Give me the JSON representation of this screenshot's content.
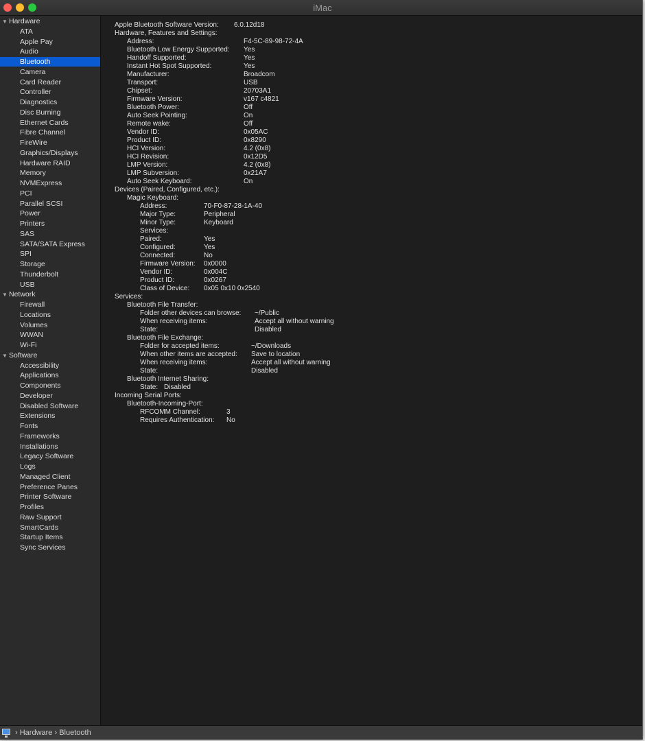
{
  "window": {
    "title": "iMac"
  },
  "sidebar": {
    "categories": [
      {
        "label": "Hardware",
        "items": [
          "ATA",
          "Apple Pay",
          "Audio",
          "Bluetooth",
          "Camera",
          "Card Reader",
          "Controller",
          "Diagnostics",
          "Disc Burning",
          "Ethernet Cards",
          "Fibre Channel",
          "FireWire",
          "Graphics/Displays",
          "Hardware RAID",
          "Memory",
          "NVMExpress",
          "PCI",
          "Parallel SCSI",
          "Power",
          "Printers",
          "SAS",
          "SATA/SATA Express",
          "SPI",
          "Storage",
          "Thunderbolt",
          "USB"
        ]
      },
      {
        "label": "Network",
        "items": [
          "Firewall",
          "Locations",
          "Volumes",
          "WWAN",
          "Wi-Fi"
        ]
      },
      {
        "label": "Software",
        "items": [
          "Accessibility",
          "Applications",
          "Components",
          "Developer",
          "Disabled Software",
          "Extensions",
          "Fonts",
          "Frameworks",
          "Installations",
          "Legacy Software",
          "Logs",
          "Managed Client",
          "Preference Panes",
          "Printer Software",
          "Profiles",
          "Raw Support",
          "SmartCards",
          "Startup Items",
          "Sync Services"
        ]
      }
    ],
    "selected": "Bluetooth"
  },
  "content": {
    "groups": [
      {
        "rows": [
          {
            "level": 0,
            "label": "Apple Bluetooth Software Version:",
            "value": "6.0.12d18"
          }
        ]
      },
      {
        "rows": [
          {
            "level": 0,
            "label": "Hardware, Features and Settings:",
            "value": ""
          },
          {
            "level": 1,
            "label": "Address:",
            "value": "F4-5C-89-98-72-4A"
          },
          {
            "level": 1,
            "label": "Bluetooth Low Energy Supported:",
            "value": "Yes"
          },
          {
            "level": 1,
            "label": "Handoff Supported:",
            "value": "Yes"
          },
          {
            "level": 1,
            "label": "Instant Hot Spot Supported:",
            "value": "Yes"
          },
          {
            "level": 1,
            "label": "Manufacturer:",
            "value": "Broadcom"
          },
          {
            "level": 1,
            "label": "Transport:",
            "value": "USB"
          },
          {
            "level": 1,
            "label": "Chipset:",
            "value": "20703A1"
          },
          {
            "level": 1,
            "label": "Firmware Version:",
            "value": "v167 c4821"
          },
          {
            "level": 1,
            "label": "Bluetooth Power:",
            "value": "Off"
          },
          {
            "level": 1,
            "label": "Auto Seek Pointing:",
            "value": "On"
          },
          {
            "level": 1,
            "label": "Remote wake:",
            "value": "Off"
          },
          {
            "level": 1,
            "label": "Vendor ID:",
            "value": "0x05AC"
          },
          {
            "level": 1,
            "label": "Product ID:",
            "value": "0x8290"
          },
          {
            "level": 1,
            "label": "HCI Version:",
            "value": "4.2 (0x8)"
          },
          {
            "level": 1,
            "label": "HCI Revision:",
            "value": "0x12D5"
          },
          {
            "level": 1,
            "label": "LMP Version:",
            "value": "4.2 (0x8)"
          },
          {
            "level": 1,
            "label": "LMP Subversion:",
            "value": "0x21A7"
          },
          {
            "level": 1,
            "label": "Auto Seek Keyboard:",
            "value": "On"
          }
        ]
      },
      {
        "rows": [
          {
            "level": 0,
            "label": "Devices (Paired, Configured, etc.):",
            "value": ""
          },
          {
            "level": 1,
            "label": "Magic Keyboard:",
            "value": ""
          },
          {
            "level": 2,
            "label": "Address:",
            "value": "70-F0-87-28-1A-40"
          },
          {
            "level": 2,
            "label": "Major Type:",
            "value": "Peripheral"
          },
          {
            "level": 2,
            "label": "Minor Type:",
            "value": "Keyboard"
          },
          {
            "level": 2,
            "label": "Services:",
            "value": ""
          },
          {
            "level": 2,
            "label": "Paired:",
            "value": "Yes"
          },
          {
            "level": 2,
            "label": "Configured:",
            "value": "Yes"
          },
          {
            "level": 2,
            "label": "Connected:",
            "value": "No"
          },
          {
            "level": 2,
            "label": "Firmware Version:",
            "value": "0x0000"
          },
          {
            "level": 2,
            "label": "Vendor ID:",
            "value": "0x004C"
          },
          {
            "level": 2,
            "label": "Product ID:",
            "value": "0x0267"
          },
          {
            "level": 2,
            "label": "Class of Device:",
            "value": "0x05 0x10 0x2540"
          }
        ]
      },
      {
        "rows": [
          {
            "level": 0,
            "label": "Services:",
            "value": ""
          },
          {
            "level": 1,
            "label": "Bluetooth File Transfer:",
            "value": ""
          },
          {
            "level": 2,
            "label": "Folder other devices can browse:",
            "value": "~/Public"
          },
          {
            "level": 2,
            "label": "When receiving items:",
            "value": "Accept all without warning"
          },
          {
            "level": 2,
            "label": "State:",
            "value": "Disabled"
          }
        ]
      },
      {
        "rows": [
          {
            "level": 1,
            "label": "Bluetooth File Exchange:",
            "value": ""
          },
          {
            "level": 2,
            "label": "Folder for accepted items:",
            "value": "~/Downloads"
          },
          {
            "level": 2,
            "label": "When other items are accepted:",
            "value": "Save to location"
          },
          {
            "level": 2,
            "label": "When receiving items:",
            "value": "Accept all without warning"
          },
          {
            "level": 2,
            "label": "State:",
            "value": "Disabled"
          }
        ]
      },
      {
        "rows": [
          {
            "level": 1,
            "label": "Bluetooth Internet Sharing:",
            "value": ""
          },
          {
            "level": 2,
            "label": "State:",
            "value": "Disabled"
          }
        ]
      },
      {
        "rows": [
          {
            "level": 0,
            "label": "Incoming Serial Ports:",
            "value": ""
          },
          {
            "level": 1,
            "label": "Bluetooth-Incoming-Port:",
            "value": ""
          },
          {
            "level": 2,
            "label": "RFCOMM Channel:",
            "value": "3"
          },
          {
            "level": 2,
            "label": "Requires Authentication:",
            "value": "No"
          }
        ]
      }
    ]
  },
  "statusbar": {
    "path": [
      "Hardware",
      "Bluetooth"
    ],
    "separator": "›"
  }
}
